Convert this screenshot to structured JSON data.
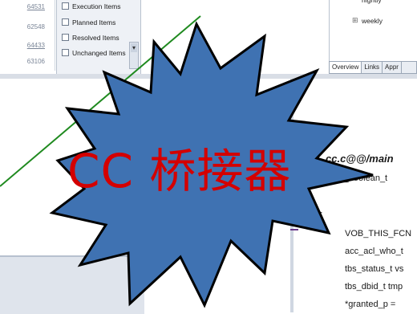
{
  "numbers_panel": {
    "values": [
      "64531",
      "62548",
      "64433",
      "63106"
    ]
  },
  "filters": {
    "items": [
      {
        "label": "Execution Items",
        "checked": false
      },
      {
        "label": "Planned Items",
        "checked": false
      },
      {
        "label": "Resolved Items",
        "checked": false
      },
      {
        "label": "Unchanged Items",
        "checked": false
      }
    ]
  },
  "tree": {
    "items": [
      "nightly",
      "weekly"
    ]
  },
  "tabs": [
    "Overview",
    "Links",
    "Appr"
  ],
  "code": {
    "heading": "cc.c@@/main",
    "lines": [
      "tbs_boolean_t",
      "VOB_THIS_FCN",
      "acc_acl_who_t",
      "tbs_status_t vs",
      "tbs_dbid_t tmp",
      "*granted_p = "
    ],
    "brace": "{"
  },
  "overlay": {
    "title": "CC 桥接器",
    "title_color": "#d40000",
    "star_fill": "#3f72b2",
    "star_stroke": "#000000"
  },
  "colors": {
    "trend_line": "#1f8a1f"
  }
}
